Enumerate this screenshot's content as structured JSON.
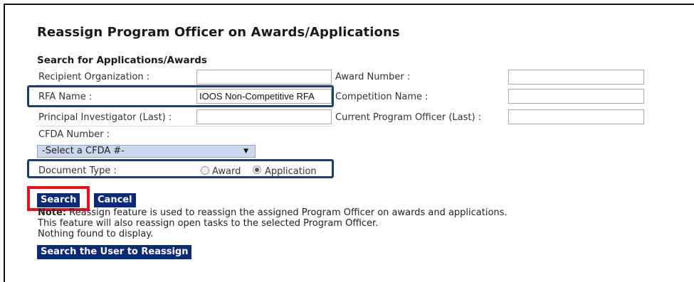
{
  "page": {
    "title": "Reassign Program Officer on Awards/Applications",
    "subtitle": "Search for Applications/Awards"
  },
  "form": {
    "recipient_org_label": "Recipient Organization :",
    "recipient_org_value": "",
    "award_number_label": "Award Number :",
    "award_number_value": "",
    "rfa_name_label": "RFA Name :",
    "rfa_name_value": "IOOS Non-Competitive RFA",
    "competition_name_label": "Competition Name :",
    "competition_name_value": "",
    "pi_last_label": "Principal Investigator (Last) :",
    "pi_last_value": "",
    "current_po_label": "Current Program Officer (Last) :",
    "current_po_value": "",
    "cfda_label": "CFDA Number :",
    "cfda_select": "-Select a CFDA #-",
    "doc_type_label": "Document Type :",
    "doc_type_options": [
      "Award",
      "Application"
    ],
    "doc_type_selected": "Application"
  },
  "buttons": {
    "search": "Search",
    "cancel": "Cancel",
    "search_user": "Search the User to Reassign"
  },
  "note": {
    "label": "Note:",
    "line1": " Reassign feature is used to reassign the assigned Program Officer on awards and applications.",
    "line2": "This feature will also reassign open tasks to the selected Program Officer.",
    "line3": "Nothing found to display."
  },
  "colors": {
    "button_bg": "#0a2a7a",
    "highlight_box": "#1f3f68",
    "highlight_red": "#e8101a",
    "select_bg": "#cbd8ee"
  },
  "icons": {
    "select_arrow": "caret-down-icon"
  }
}
